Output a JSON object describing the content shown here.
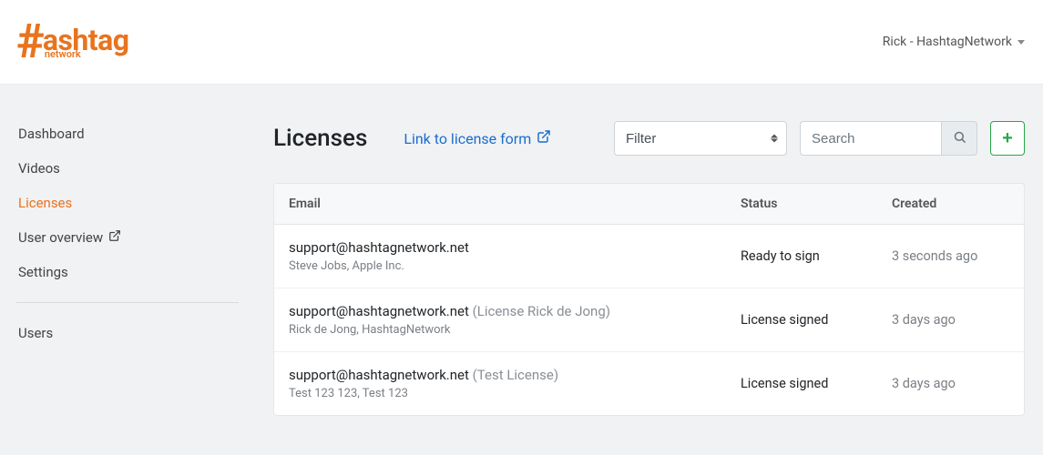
{
  "header": {
    "logo_main": "ashtag",
    "logo_sub": "network",
    "user_label": "Rick - HashtagNetwork"
  },
  "sidebar": {
    "items": [
      {
        "label": "Dashboard"
      },
      {
        "label": "Videos"
      },
      {
        "label": "Licenses"
      },
      {
        "label": "User overview"
      },
      {
        "label": "Settings"
      }
    ],
    "items2": [
      {
        "label": "Users"
      }
    ]
  },
  "page": {
    "title": "Licenses",
    "form_link": "Link to license form",
    "filter_placeholder": "Filter",
    "search_placeholder": "Search"
  },
  "table": {
    "headers": {
      "email": "Email",
      "status": "Status",
      "created": "Created"
    },
    "rows": [
      {
        "email": "support@hashtagnetwork.net",
        "tag": "",
        "sub": "Steve Jobs, Apple Inc.",
        "status": "Ready to sign",
        "created": "3 seconds ago"
      },
      {
        "email": "support@hashtagnetwork.net",
        "tag": " (License Rick de Jong)",
        "sub": "Rick de Jong, HashtagNetwork",
        "status": "License signed",
        "created": "3 days ago"
      },
      {
        "email": "support@hashtagnetwork.net",
        "tag": " (Test License)",
        "sub": "Test 123 123, Test 123",
        "status": "License signed",
        "created": "3 days ago"
      }
    ]
  }
}
